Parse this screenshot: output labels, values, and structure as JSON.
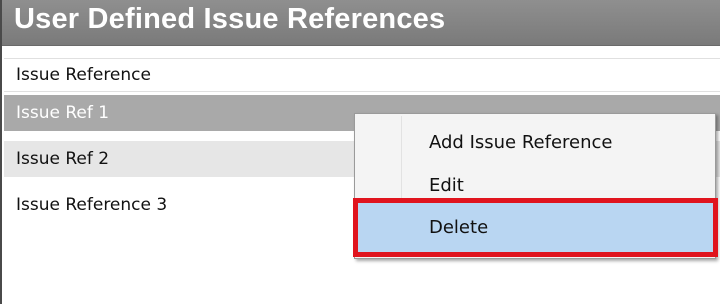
{
  "window": {
    "title": "User Defined Issue References"
  },
  "table": {
    "column_header": "Issue Reference",
    "rows": [
      {
        "label": "Issue Ref 1",
        "state": "selected"
      },
      {
        "label": "Issue Ref 2",
        "state": "hover"
      },
      {
        "label": "Issue Reference 3",
        "state": "normal"
      }
    ]
  },
  "context_menu": {
    "items": [
      {
        "label": "Add Issue Reference"
      },
      {
        "label": "Edit"
      },
      {
        "label": "Delete",
        "state": "highlighted"
      }
    ]
  },
  "colors": {
    "title_bar": "#858585",
    "selected_row": "#a9a9a9",
    "hover_row": "#e6e6e6",
    "menu_highlight": "#b9d6f2",
    "annotation_outline": "#e0141e"
  }
}
